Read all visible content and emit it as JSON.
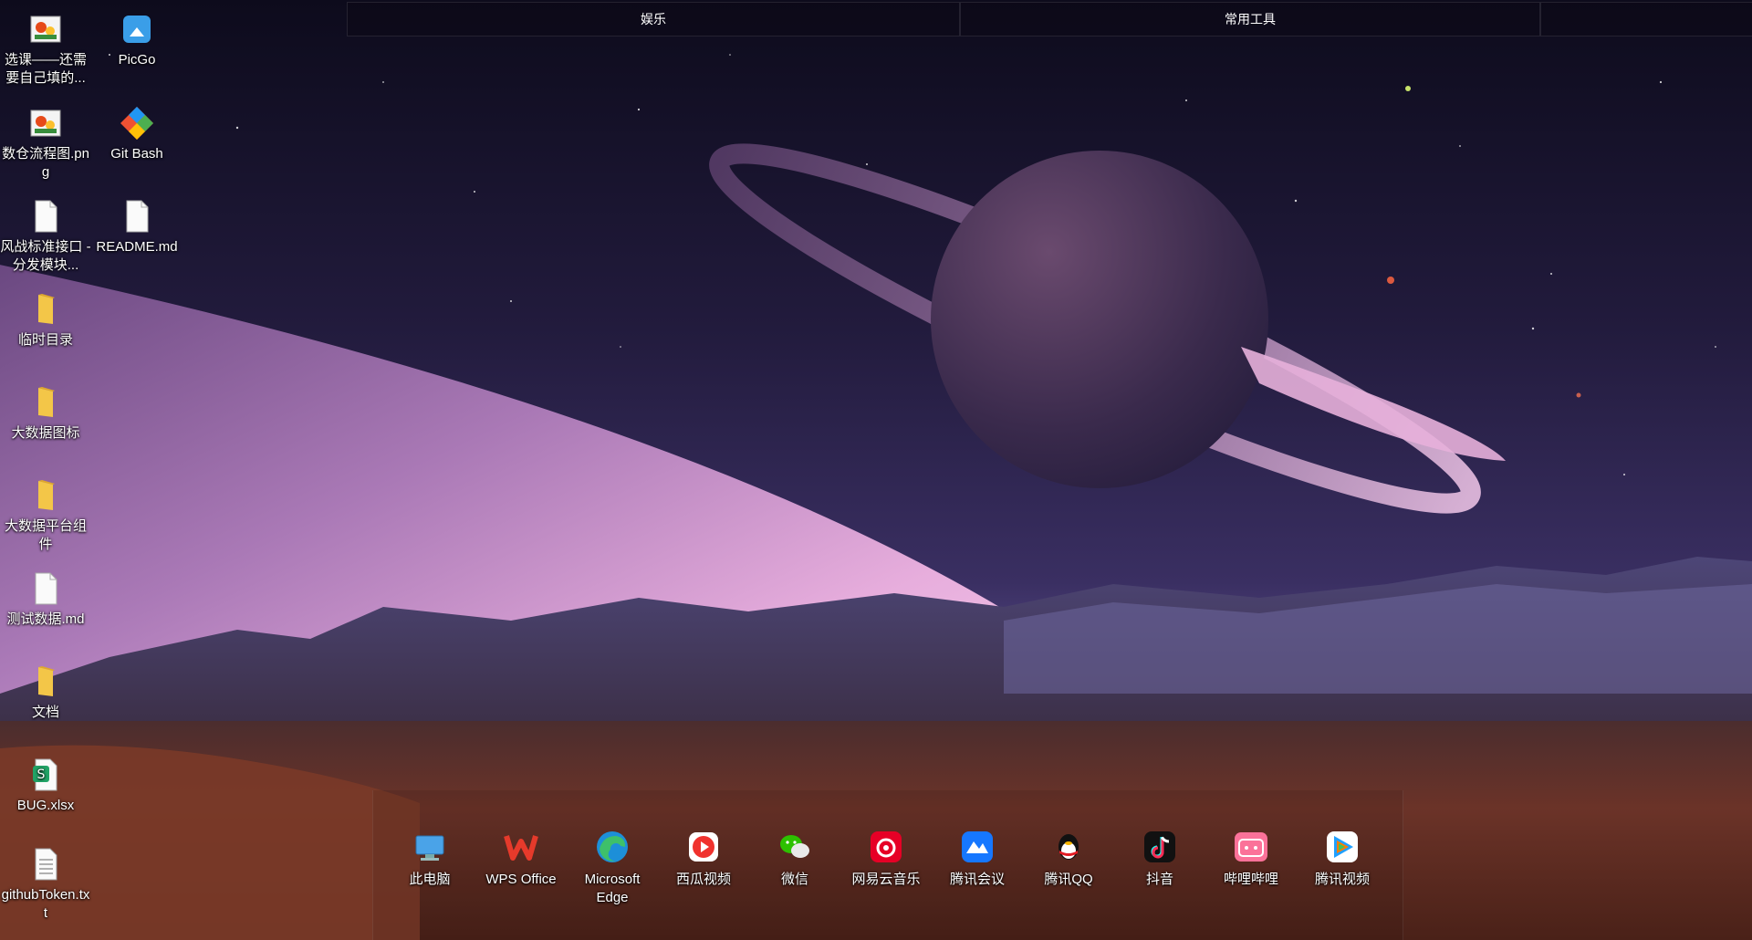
{
  "fences": [
    {
      "label": "娱乐"
    },
    {
      "label": "常用工具"
    },
    {
      "label": ""
    }
  ],
  "desktop_icons": [
    {
      "label": "选课——还需要自己填的...",
      "icon": "image-file-icon"
    },
    {
      "label": "PicGo",
      "icon": "picgo-icon"
    },
    {
      "label": "数仓流程图.png",
      "icon": "image-file-icon"
    },
    {
      "label": "Git Bash",
      "icon": "git-bash-icon"
    },
    {
      "label": "风战标准接口 - 分发模块...",
      "icon": "document-file-icon"
    },
    {
      "label": "README.md",
      "icon": "document-file-icon"
    },
    {
      "label": "临时目录",
      "icon": "folder-icon"
    },
    {
      "label": "大数据图标",
      "icon": "folder-icon"
    },
    {
      "label": "大数据平台组件",
      "icon": "folder-icon"
    },
    {
      "label": "测试数据.md",
      "icon": "document-file-icon"
    },
    {
      "label": "文档",
      "icon": "folder-icon"
    },
    {
      "label": "BUG.xlsx",
      "icon": "spreadsheet-file-icon"
    },
    {
      "label": "githubToken.txt",
      "icon": "text-file-icon"
    }
  ],
  "dock_items": [
    {
      "label": "此电脑",
      "icon": "computer-icon"
    },
    {
      "label": "WPS Office",
      "icon": "wps-office-icon"
    },
    {
      "label": "Microsoft Edge",
      "icon": "edge-icon"
    },
    {
      "label": "西瓜视频",
      "icon": "xigua-video-icon"
    },
    {
      "label": "微信",
      "icon": "wechat-icon"
    },
    {
      "label": "网易云音乐",
      "icon": "netease-music-icon"
    },
    {
      "label": "腾讯会议",
      "icon": "tencent-meeting-icon"
    },
    {
      "label": "腾讯QQ",
      "icon": "qq-icon"
    },
    {
      "label": "抖音",
      "icon": "douyin-icon"
    },
    {
      "label": "哔哩哔哩",
      "icon": "bilibili-icon"
    },
    {
      "label": "腾讯视频",
      "icon": "tencent-video-icon"
    }
  ],
  "colors": {
    "sky_top": "#0d0b1c",
    "sky_mid": "#2f2450",
    "planet_pink": "#e7a3d6",
    "ground": "#6b3328"
  }
}
